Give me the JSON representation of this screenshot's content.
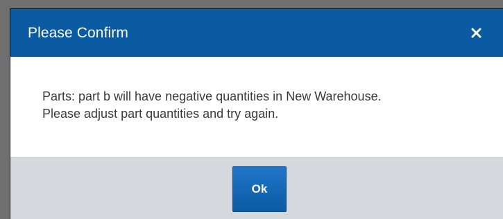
{
  "dialog": {
    "title": "Please Confirm",
    "close_icon": "close-icon",
    "message_lines": [
      "Parts: part b will have negative quantities in New Warehouse.",
      "Please adjust part quantities and try again."
    ],
    "ok_label": "Ok"
  },
  "colors": {
    "header": "#0b5ba3",
    "footer": "#d5d9de",
    "button": "#0b5ba3",
    "text": "#3a3a3a"
  }
}
